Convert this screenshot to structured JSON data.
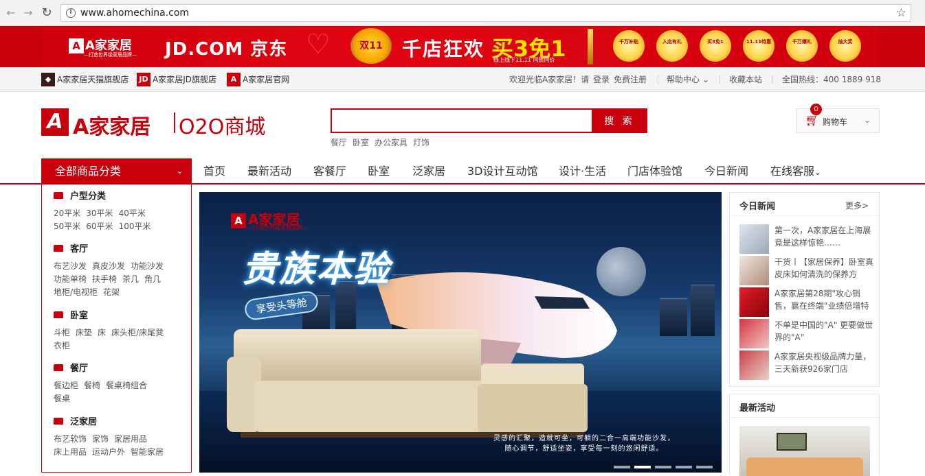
{
  "browser": {
    "url": "www.ahomechina.com"
  },
  "promo": {
    "logo_text": "A家家居",
    "logo_sub": "—打造世界级家居品牌—",
    "partner": "JD.COM 京东",
    "badge": "双11",
    "title": "千店狂欢",
    "offer": "买3免1",
    "date_note": "线上线下11.11  同质同价",
    "coins": [
      "千万补贴",
      "入店有礼",
      "买3免1",
      "11.11特惠",
      "千万爆礼",
      "抽大奖"
    ]
  },
  "util_bar": {
    "links": [
      "A家家居天猫旗舰店",
      "A家家居JD旗舰店",
      "A家家居官网"
    ],
    "welcome": "欢迎光临A家家居！请",
    "login": "登录",
    "register": "免费注册",
    "help": "帮助中心",
    "favorite": "收藏本站",
    "hotline": "全国热线：400 1889 918"
  },
  "header": {
    "brand_name": "A家家居",
    "brand_sub": "O2O商城",
    "search_button": "搜 索",
    "search_value": "",
    "hot_words": [
      "餐厅",
      "卧室",
      "办公家具",
      "灯饰"
    ],
    "cart_label": "购物车",
    "cart_count": "0"
  },
  "nav": {
    "all_categories": "全部商品分类",
    "items": [
      "首页",
      "最新活动",
      "客餐厅",
      "卧室",
      "泛家居",
      "3D设计互动馆",
      "设计·生活",
      "门店体验馆",
      "今日新闻",
      "在线客服"
    ]
  },
  "categories": [
    {
      "title": "户型分类",
      "links": [
        "20平米",
        "30平米",
        "40平米",
        "50平米",
        "60平米",
        "100平米"
      ]
    },
    {
      "title": "客厅",
      "links": [
        "布艺沙发",
        "真皮沙发",
        "功能沙发",
        "功能单椅",
        "扶手椅",
        "茶几",
        "角几",
        "地柜/电视柜",
        "花架"
      ]
    },
    {
      "title": "卧室",
      "links": [
        "斗柜",
        "床垫",
        "床",
        "床头柜/床尾凳",
        "衣柜"
      ]
    },
    {
      "title": "餐厅",
      "links": [
        "餐边柜",
        "餐椅",
        "餐桌椅组合",
        "餐桌"
      ]
    },
    {
      "title": "泛家居",
      "links": [
        "布艺软饰",
        "家饰",
        "家居用品",
        "床上用品",
        "运动户外",
        "智能家居"
      ]
    }
  ],
  "hero": {
    "logo_text": "A家家居",
    "logo_sub": "—打造世界级家居品牌—",
    "headline": "贵族本验",
    "tag": "享受头等舱",
    "caption_line1": "灵感的汇聚，造就可坐，可躺的二合一高端功能沙发，",
    "caption_line2": "随心调节，舒适坐姿，享受每一刻的悠闲舒适。",
    "slide_count": 5,
    "active_slide": 2
  },
  "news_panel": {
    "title": "今日新闻",
    "more": "更多>",
    "items": [
      "第一次，A家家居在上海展竟是这样惊艳……",
      "干货丨【家居保养】卧室真皮床如何清洗的保养方",
      "A家家居第28期\"攻心销售，赢在终端\"业绩倍增特",
      "不单是中国的\"A\" 更要做世界的\"A\"",
      "A家家居央视级品牌力量，三天新获926家门店"
    ]
  },
  "activity_panel": {
    "title": "最新活动"
  },
  "colors": {
    "brand_red": "#c7000b"
  }
}
